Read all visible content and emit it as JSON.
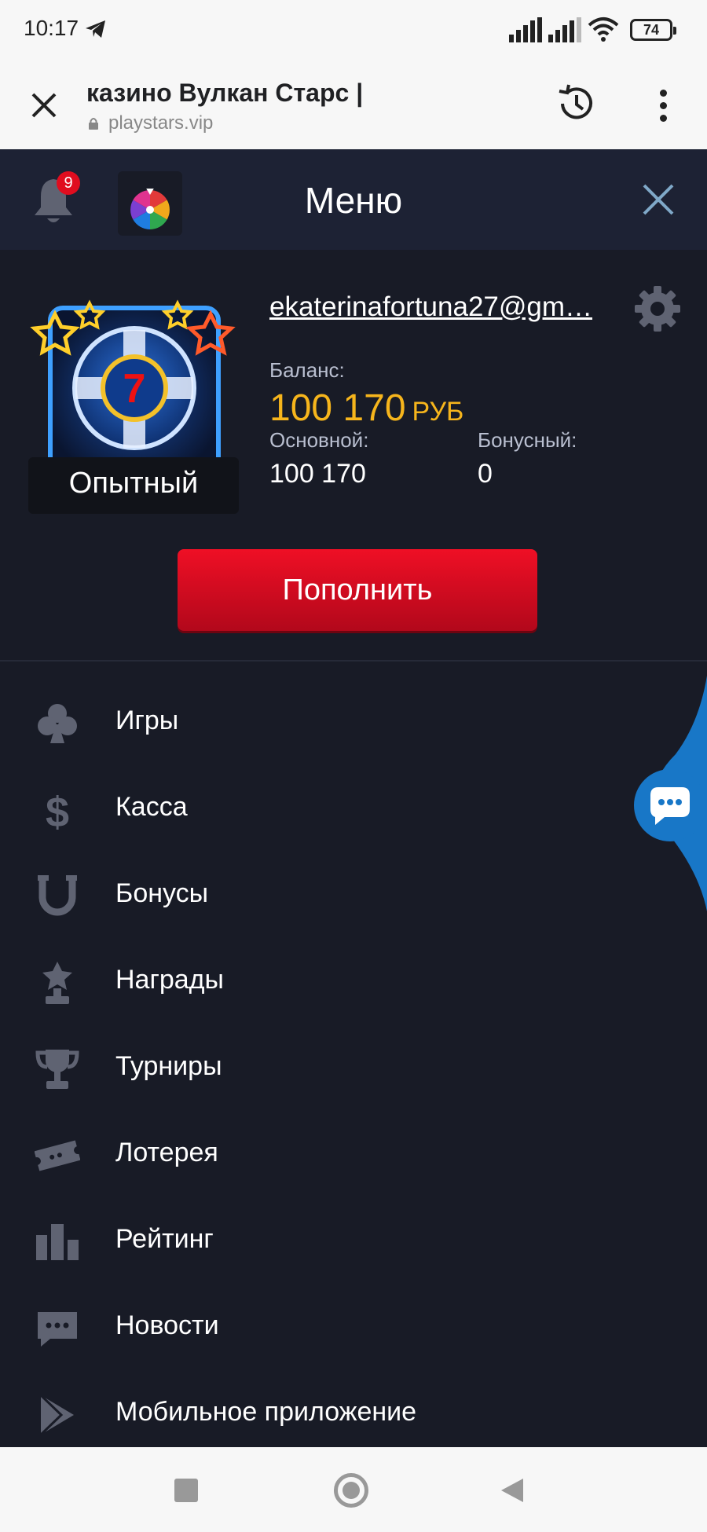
{
  "status_bar": {
    "time": "10:17",
    "battery": "74"
  },
  "browser": {
    "title": "казино Вулкан Старс |",
    "url": "playstars.vip"
  },
  "header": {
    "title": "Меню",
    "notification_count": "9"
  },
  "profile": {
    "email": "ekaterinafortuna27@gm…",
    "level": "Опытный",
    "balance_label": "Баланс:",
    "balance_amount": "100 170",
    "balance_currency": "РУБ",
    "main_label": "Основной:",
    "main_value": "100 170",
    "bonus_label": "Бонусный:",
    "bonus_value": "0"
  },
  "deposit_button": "Пополнить",
  "menu": {
    "items": [
      {
        "label": "Игры",
        "icon": "clover-icon"
      },
      {
        "label": "Касса",
        "icon": "dollar-icon"
      },
      {
        "label": "Бонусы",
        "icon": "horseshoe-icon"
      },
      {
        "label": "Награды",
        "icon": "award-icon"
      },
      {
        "label": "Турниры",
        "icon": "trophy-icon"
      },
      {
        "label": "Лотерея",
        "icon": "ticket-icon"
      },
      {
        "label": "Рейтинг",
        "icon": "rating-bars-icon"
      },
      {
        "label": "Новости",
        "icon": "news-chat-icon"
      },
      {
        "label": "Мобильное приложение",
        "icon": "play-store-icon"
      }
    ]
  },
  "colors": {
    "background": "#181b26",
    "header_bg": "#1d2234",
    "balance_gold": "#f6b51c",
    "button_red": "#e00d1f",
    "icon_gray": "#5f6372",
    "chat_blue": "#1877c7"
  }
}
